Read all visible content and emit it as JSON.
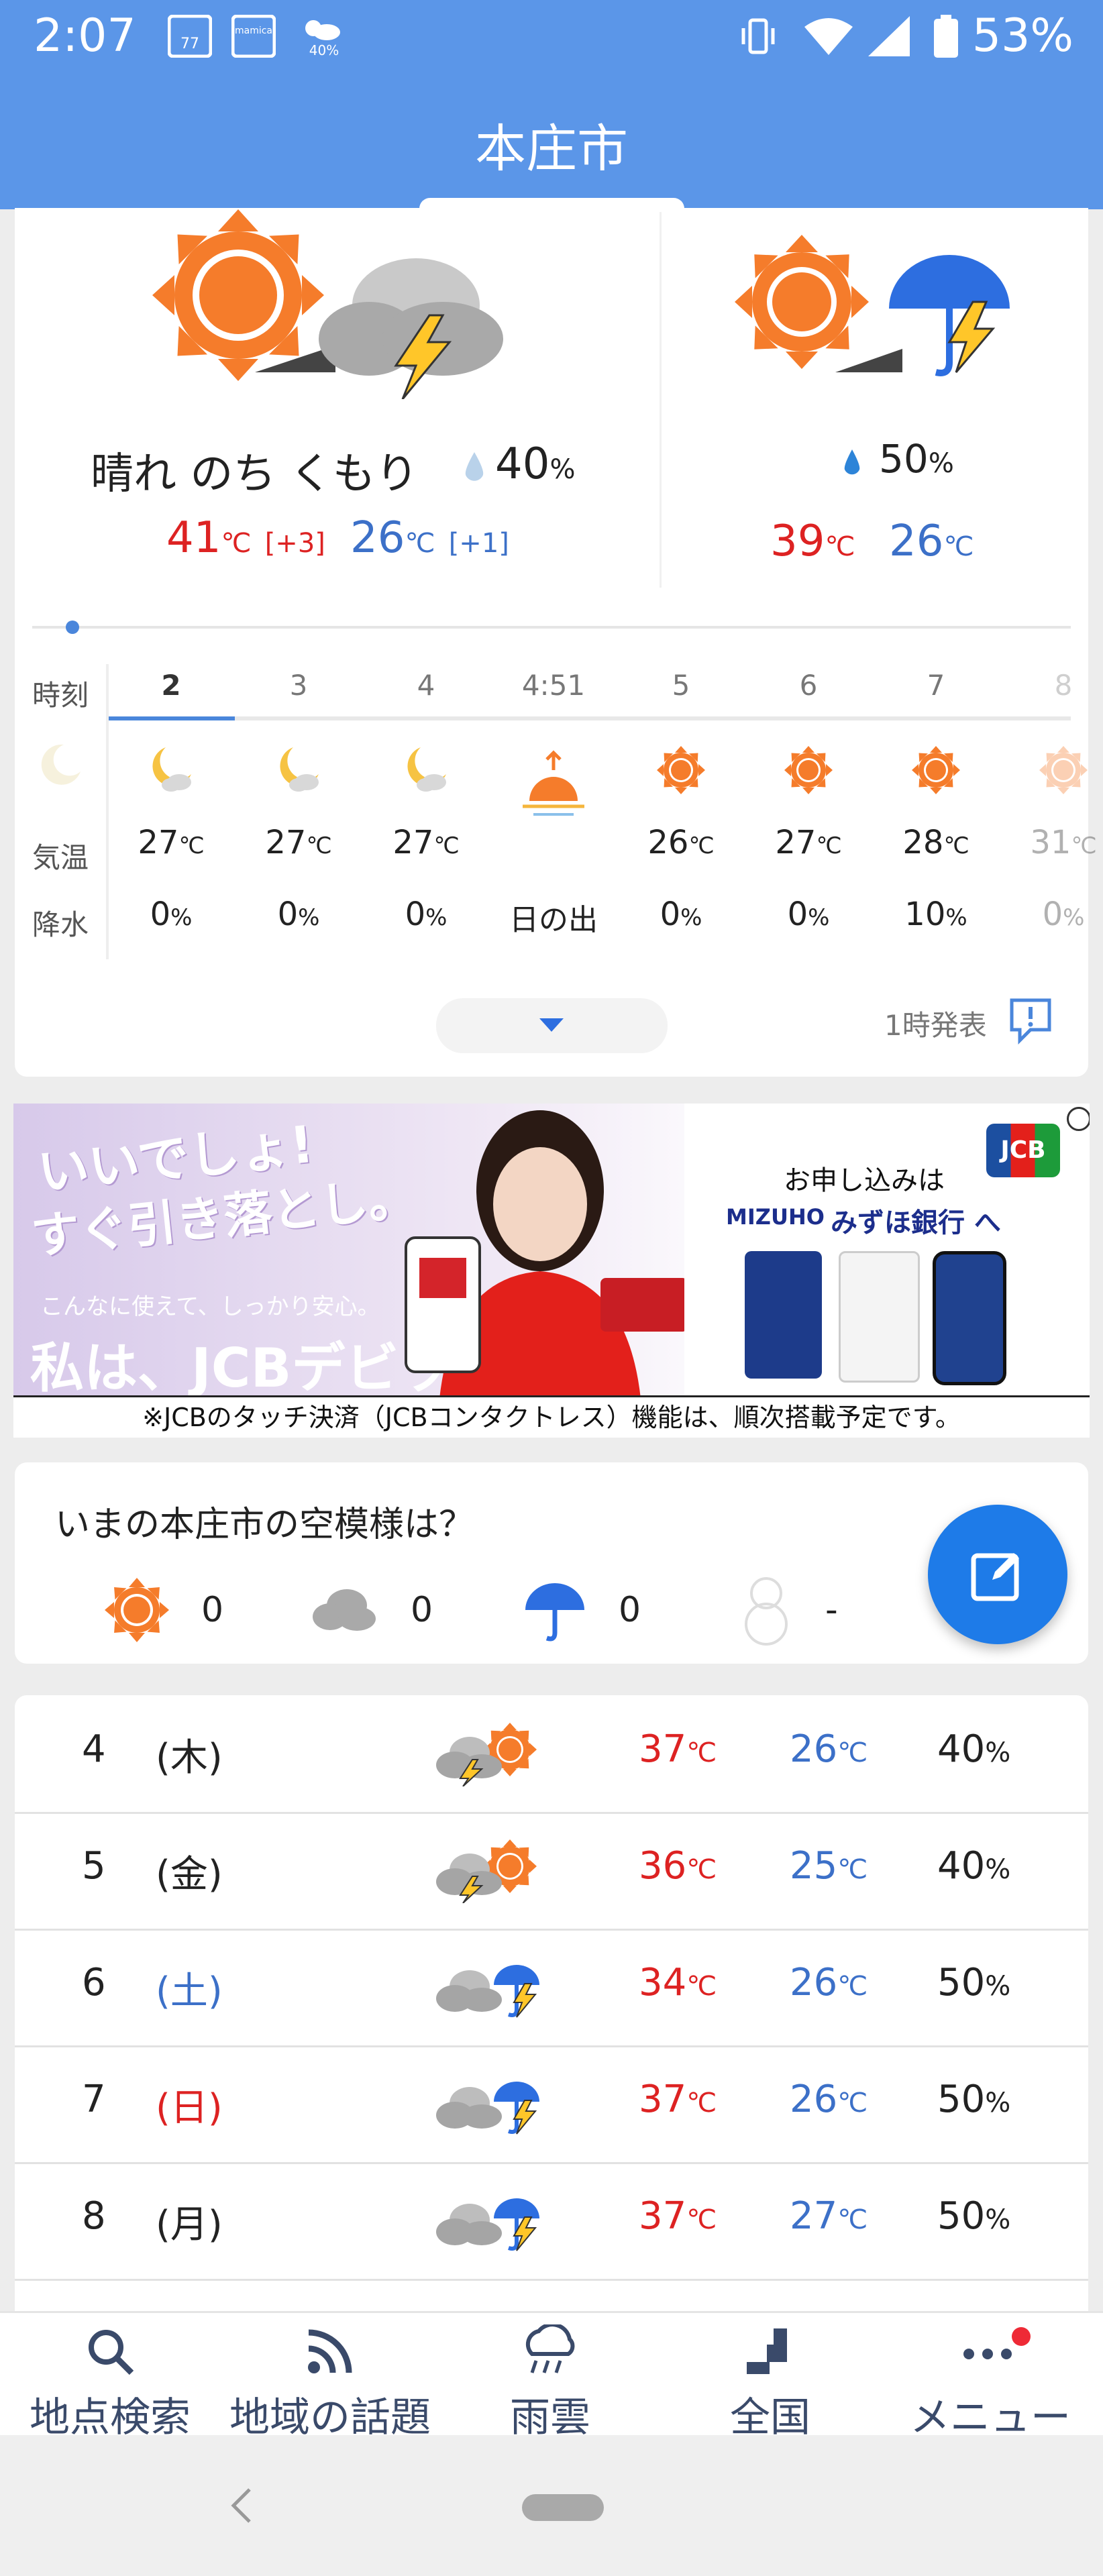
{
  "status_bar": {
    "time": "2:07",
    "icon1_text": "77",
    "icon2_text": "mamica",
    "icon3_text": "40%",
    "battery": "53%"
  },
  "header": {
    "title": "本庄市"
  },
  "today": {
    "condition": "晴れ のち くもり",
    "rain_chance": "40",
    "rain_unit": "%",
    "high": "41",
    "high_diff": "[+3]",
    "low": "26",
    "low_diff": "[+1]",
    "unit": "℃"
  },
  "tomorrow": {
    "rain_chance": "50",
    "rain_unit": "%",
    "high": "39",
    "low": "26",
    "unit": "℃"
  },
  "hourly": {
    "row_labels": {
      "time": "時刻",
      "temp": "気温",
      "precip": "降水"
    },
    "columns": [
      {
        "time": "2",
        "temp": "27",
        "precip": "0",
        "icon": "moon-cloud-icon"
      },
      {
        "time": "3",
        "temp": "27",
        "precip": "0",
        "icon": "moon-cloud-icon"
      },
      {
        "time": "4",
        "temp": "27",
        "precip": "0",
        "icon": "moon-cloud-icon"
      },
      {
        "time": "4:51",
        "temp": "",
        "precip": "日の出",
        "icon": "sunrise-icon"
      },
      {
        "time": "5",
        "temp": "26",
        "precip": "0",
        "icon": "sun-icon"
      },
      {
        "time": "6",
        "temp": "27",
        "precip": "0",
        "icon": "sun-icon"
      },
      {
        "time": "7",
        "temp": "28",
        "precip": "10",
        "icon": "sun-icon"
      },
      {
        "time": "8",
        "temp": "31",
        "precip": "0",
        "icon": "sun-icon"
      }
    ],
    "announce": "1時発表"
  },
  "ad": {
    "headline1": "いいでしょ!",
    "headline2": "すぐ引き落とし。",
    "sub": "こんなに使えて、しっかり安心。",
    "main": "私は、JCBデビット",
    "apply": "お申し込みは",
    "bank_en": "MIZUHO",
    "bank": "みずほ銀行 へ",
    "brand": "JCB",
    "footnote": "※JCBのタッチ決済（JCBコンタクトレス）機能は、順次搭載予定です。"
  },
  "sky_poll": {
    "title": "いまの本庄市の空模様は？",
    "sunny": "0",
    "cloudy": "0",
    "rain": "0",
    "snow": "-"
  },
  "forecast": [
    {
      "date": "4",
      "dow": "(木)",
      "dow_color": "#222222",
      "hi": "37",
      "lo": "26",
      "pop": "40",
      "icon": "cloud-thunder-sun-icon"
    },
    {
      "date": "5",
      "dow": "(金)",
      "dow_color": "#222222",
      "hi": "36",
      "lo": "25",
      "pop": "40",
      "icon": "cloud-thunder-sun-icon"
    },
    {
      "date": "6",
      "dow": "(土)",
      "dow_color": "#3c70c8",
      "hi": "34",
      "lo": "26",
      "pop": "50",
      "icon": "cloud-umbrella-icon"
    },
    {
      "date": "7",
      "dow": "(日)",
      "dow_color": "#dd2222",
      "hi": "37",
      "lo": "26",
      "pop": "50",
      "icon": "cloud-umbrella-icon"
    },
    {
      "date": "8",
      "dow": "(月)",
      "dow_color": "#222222",
      "hi": "37",
      "lo": "27",
      "pop": "50",
      "icon": "cloud-umbrella-icon"
    }
  ],
  "units": {
    "temp": "℃",
    "pct": "%"
  },
  "bottom_nav": [
    {
      "label": "地点検索",
      "icon": "search-icon"
    },
    {
      "label": "地域の話題",
      "icon": "rss-icon"
    },
    {
      "label": "雨雲",
      "icon": "rain-cloud-icon"
    },
    {
      "label": "全国",
      "icon": "map-icon"
    },
    {
      "label": "メニュー",
      "icon": "more-icon"
    }
  ],
  "colors": {
    "header": "#5b96e8",
    "sun": "#f57c2b",
    "hi": "#dd2222",
    "lo": "#3c70c8",
    "fab": "#1e7be8"
  }
}
